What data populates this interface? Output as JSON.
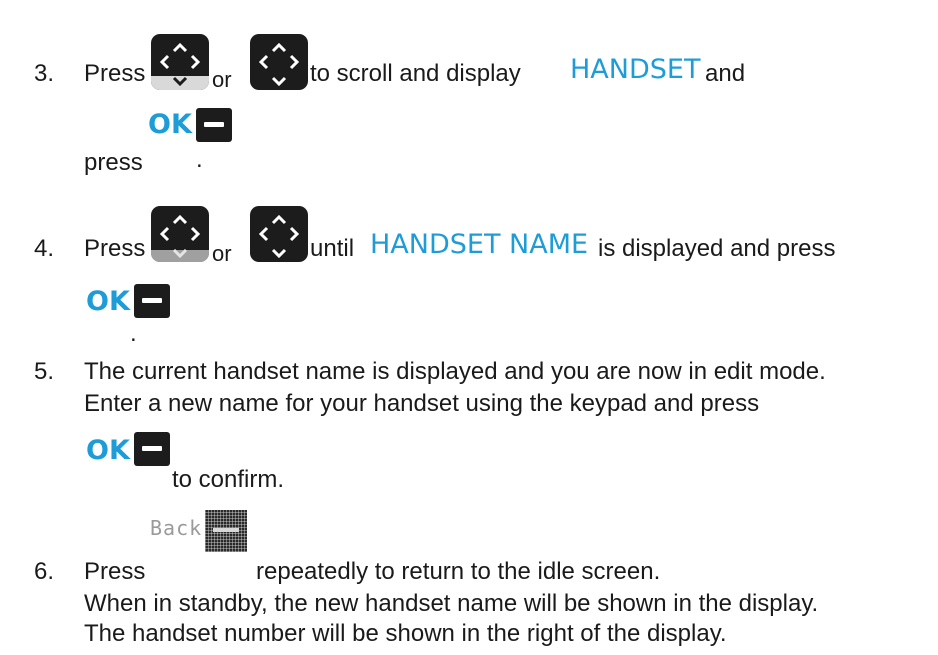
{
  "steps": [
    {
      "number": "3.",
      "press": "Press",
      "or": "or",
      "middle": "to scroll and display",
      "screen_text": "HANDSET",
      "tail": "and",
      "line2_press": "press",
      "ok_label": "OK",
      "end": "."
    },
    {
      "number": "4.",
      "press": "Press",
      "or": "or",
      "middle": "until",
      "screen_text": "HANDSET NAME",
      "tail": "is displayed and press",
      "ok_label": "OK",
      "end": "."
    },
    {
      "number": "5.",
      "line1": "The current handset name is displayed and you are now in edit mode.",
      "line2": "Enter a new name for your handset using the keypad and press",
      "ok_label": "OK",
      "end": "to confirm."
    },
    {
      "number": "6.",
      "press": "Press",
      "back_label": "Back",
      "tail": "repeatedly to return to the idle screen.",
      "line2": "When in standby, the new handset name will be shown in the display.",
      "line3": "The handset number will be shown in the right of the display."
    }
  ],
  "icons": {
    "navigation_key": "nav-key-icon",
    "ok_softkey": "minus-softkey-icon",
    "back_softkey": "back-softkey-icon"
  },
  "colors": {
    "screen_text": "#1e9cd8",
    "key_body": "#1c1c1c"
  }
}
